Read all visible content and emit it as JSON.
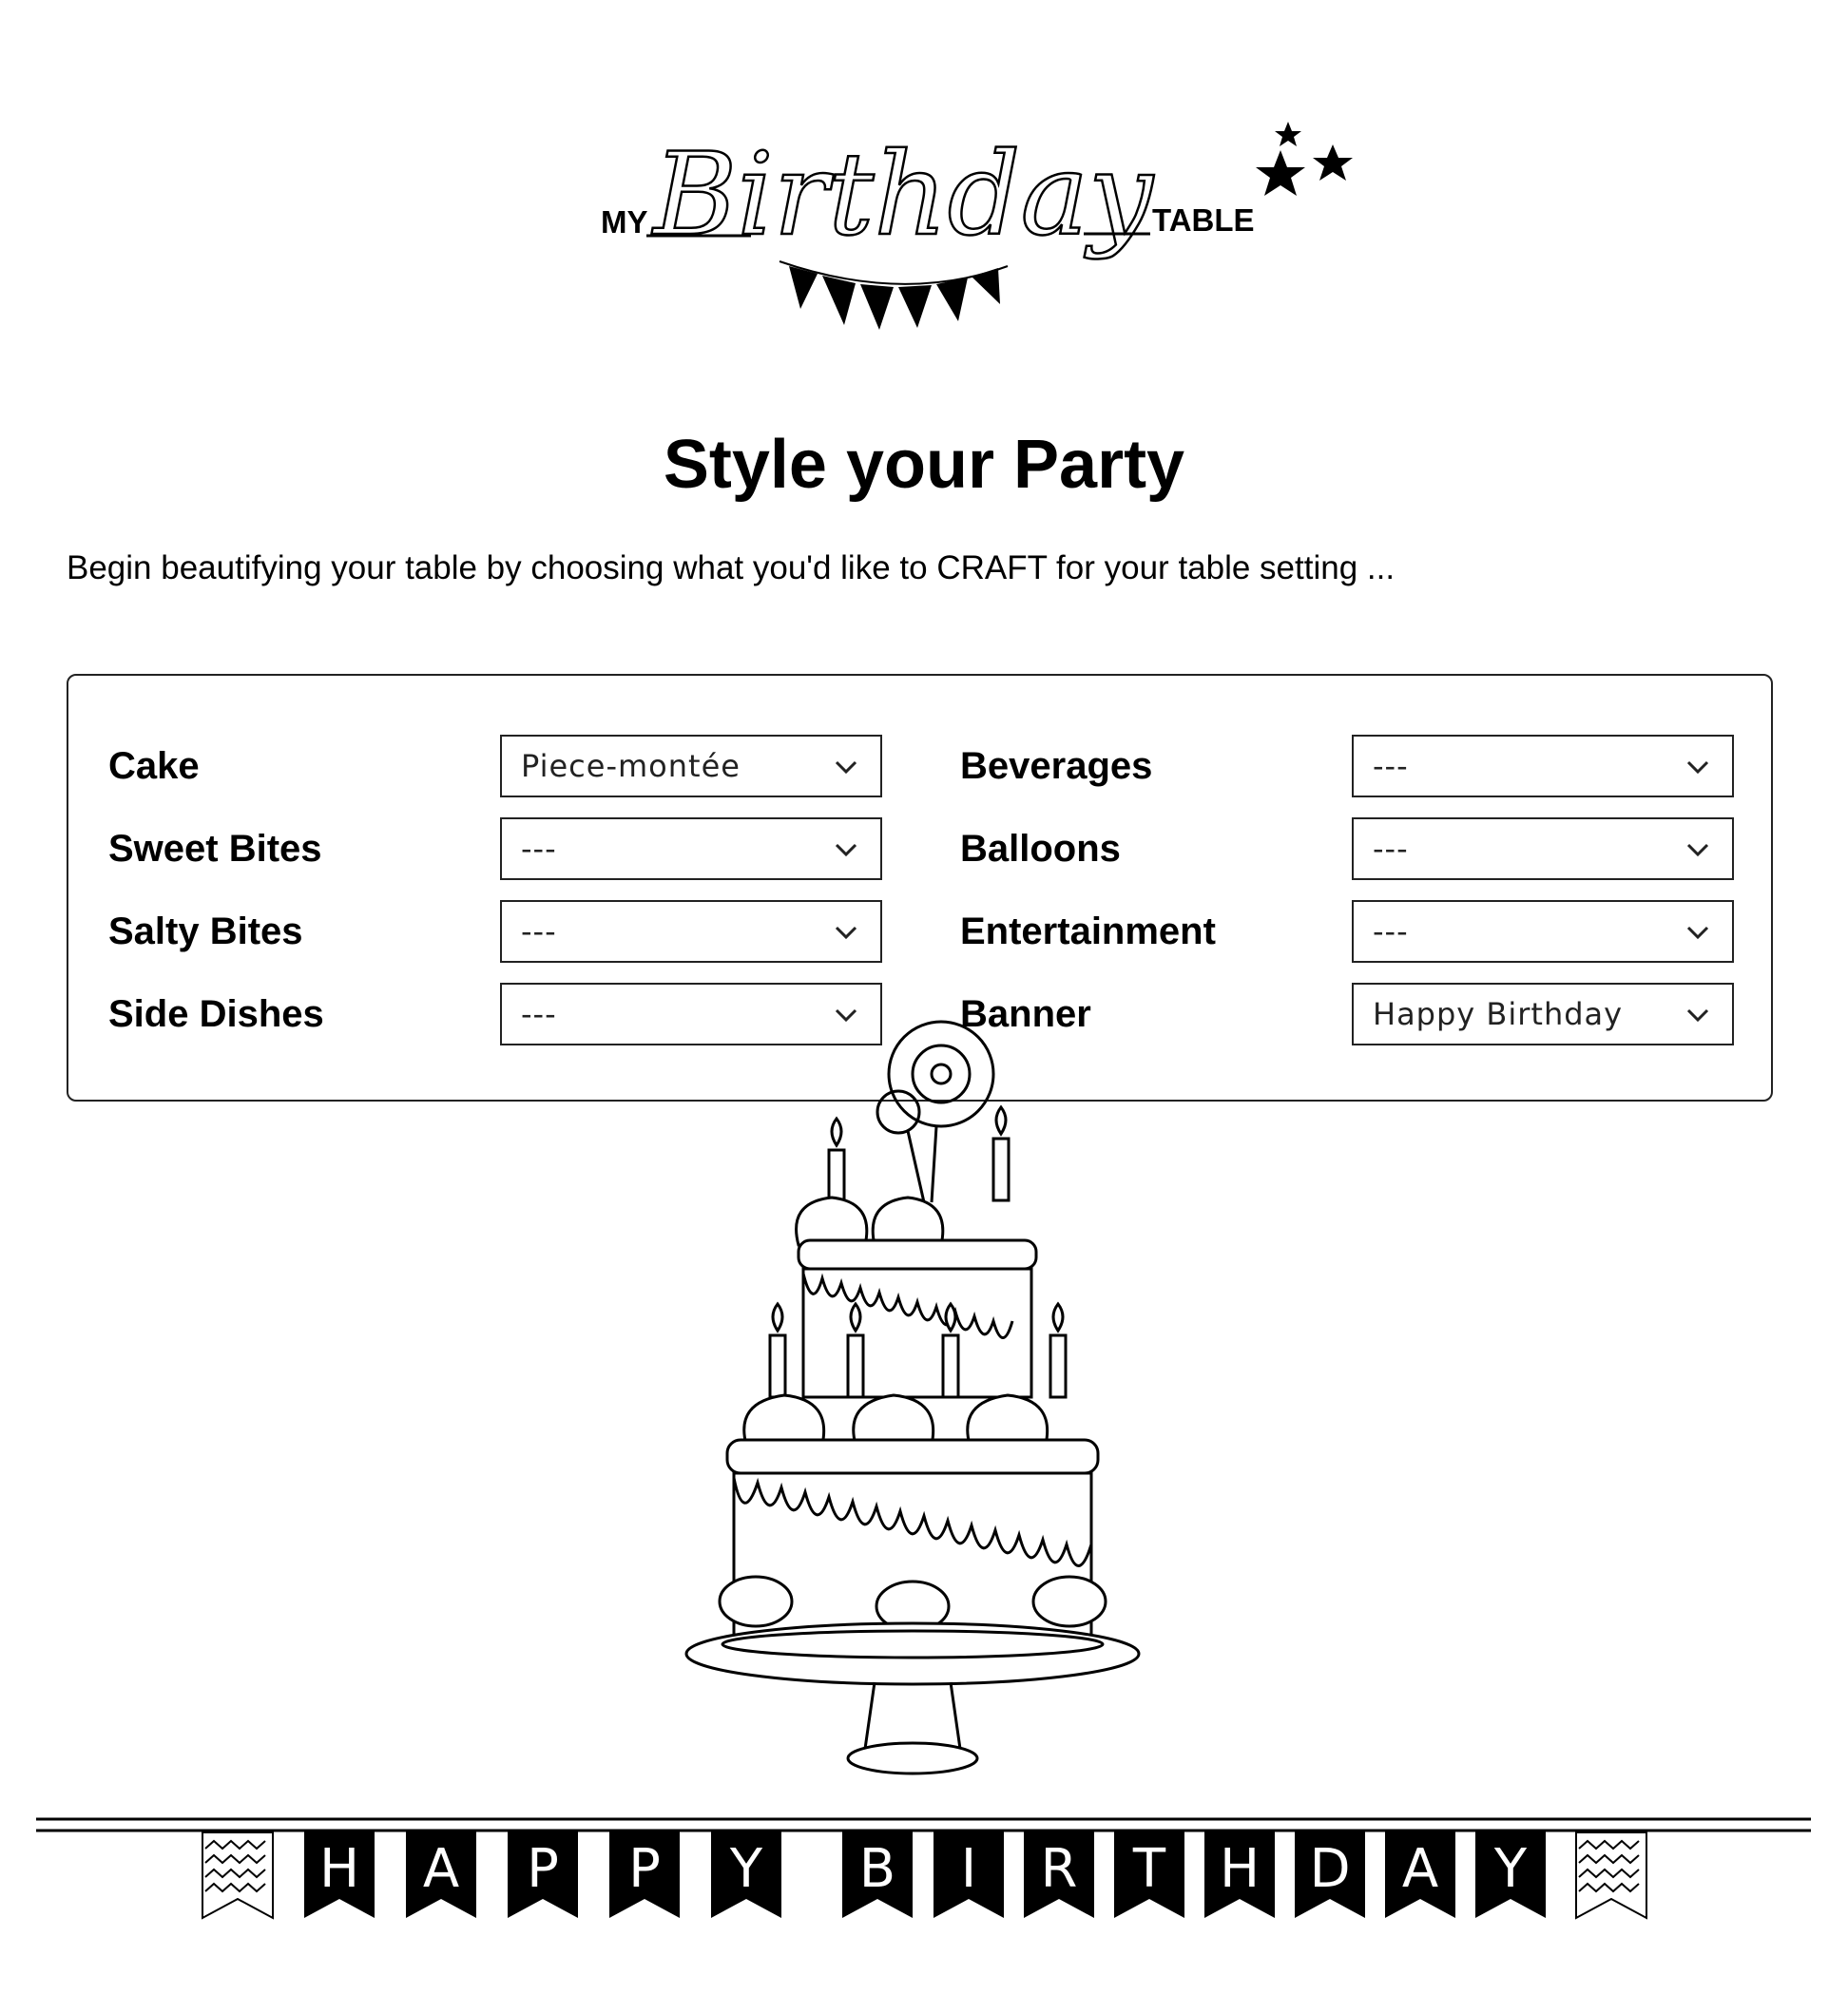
{
  "logo": {
    "prefix": "MY",
    "script_word": "Birthday",
    "suffix": "TABLE"
  },
  "page": {
    "title": "Style your Party",
    "intro": "Begin beautifying your table by choosing what you'd like to CRAFT for your table setting ..."
  },
  "form": {
    "fields": [
      {
        "label": "Cake",
        "value": "Piece-montée"
      },
      {
        "label": "Sweet Bites",
        "value": "---"
      },
      {
        "label": "Salty Bites",
        "value": "---"
      },
      {
        "label": "Side Dishes",
        "value": "---"
      },
      {
        "label": "Beverages",
        "value": "---"
      },
      {
        "label": "Balloons",
        "value": "---"
      },
      {
        "label": "Entertainment",
        "value": "---"
      },
      {
        "label": "Banner",
        "value": "Happy Birthday"
      }
    ]
  },
  "banner": {
    "letters": [
      "H",
      "A",
      "P",
      "P",
      "Y",
      "B",
      "I",
      "R",
      "T",
      "H",
      "D",
      "A",
      "Y"
    ]
  }
}
